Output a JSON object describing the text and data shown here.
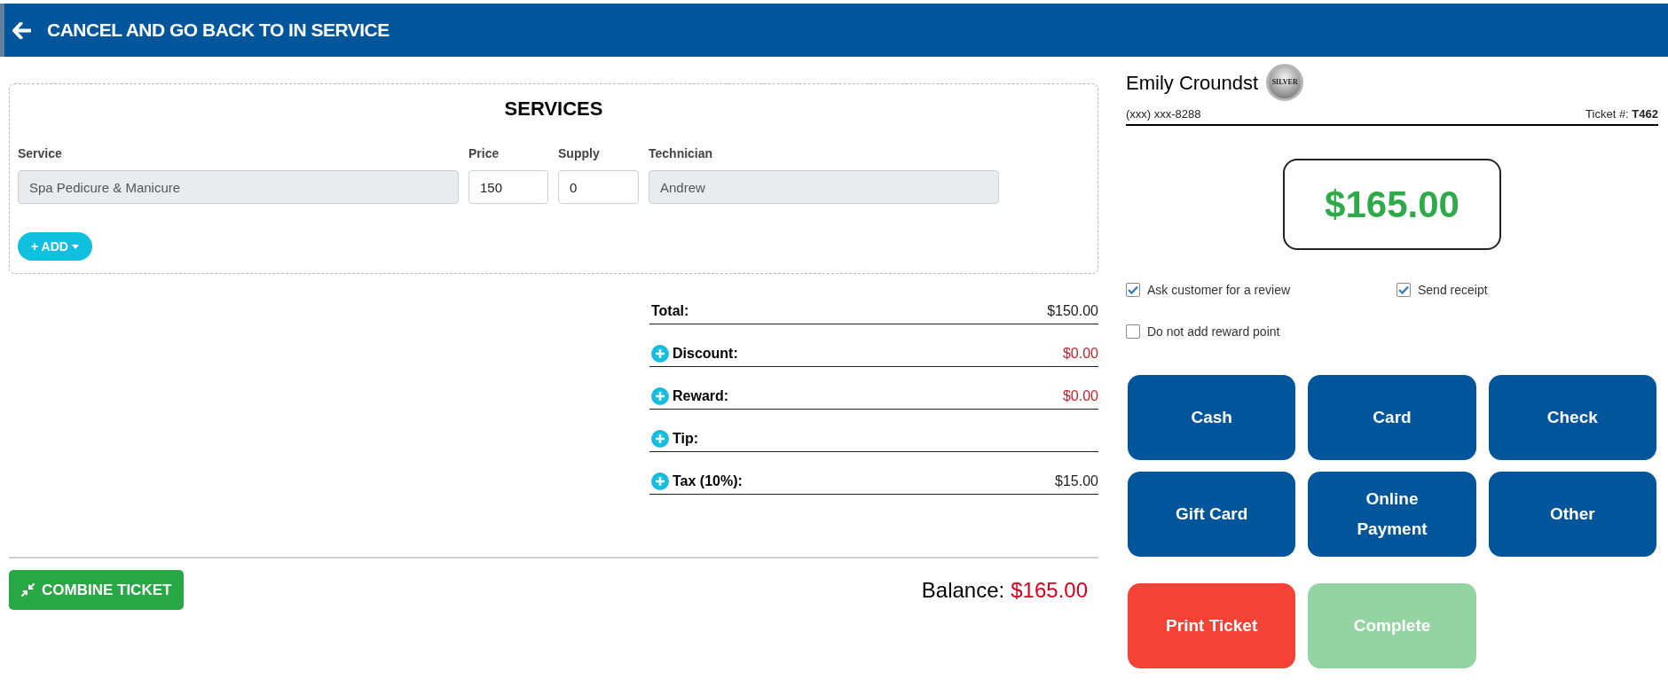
{
  "header": {
    "back_label": "CANCEL AND GO BACK TO IN SERVICE"
  },
  "services": {
    "title": "SERVICES",
    "columns": [
      "Service",
      "Price",
      "Supply",
      "Technician"
    ],
    "rows": [
      {
        "cells": [
          {
            "value": "Spa Pedicure & Manicure",
            "disabled": true
          },
          {
            "value": "150",
            "disabled": false
          },
          {
            "value": "0",
            "disabled": false
          },
          {
            "value": "Andrew",
            "disabled": true
          }
        ]
      }
    ],
    "add_button": "+ ADD"
  },
  "totals": [
    {
      "label": "Total:",
      "value": "$150.00",
      "addable": false,
      "kind": "charge"
    },
    {
      "label": "Discount:",
      "value": "$0.00",
      "addable": true,
      "kind": "deduction"
    },
    {
      "label": "Reward:",
      "value": "$0.00",
      "addable": true,
      "kind": "deduction"
    },
    {
      "label": "Tip:",
      "addable": true,
      "kind": "charge"
    },
    {
      "label": "Tax (10%):",
      "value": "$15.00",
      "addable": true,
      "kind": "charge"
    }
  ],
  "combine_button": "COMBINE TICKET",
  "balance": {
    "label": "Balance:",
    "value": "$165.00"
  },
  "customer": {
    "name": "Emily Croundst",
    "tier": "SILVER",
    "phone": "(xxx) xxx-8288",
    "ticket": "Ticket #: **T462**"
  },
  "amount_due": "$165.00",
  "options": [
    {
      "label": "Ask customer for a review",
      "checked": true
    },
    {
      "label": "Send receipt",
      "checked": true
    },
    {
      "label": "Do not add reward point",
      "checked": false
    }
  ],
  "payment_methods": [
    {
      "label": "Cash"
    },
    {
      "label": "Card"
    },
    {
      "label": "Check"
    },
    {
      "label": "Gift Card"
    },
    {
      "label": "Online Payment"
    },
    {
      "label": "Other"
    }
  ],
  "actions": [
    {
      "label": "Print Ticket",
      "kind": "print",
      "disabled": false
    },
    {
      "label": "Complete",
      "kind": "complete",
      "disabled": true
    }
  ]
}
